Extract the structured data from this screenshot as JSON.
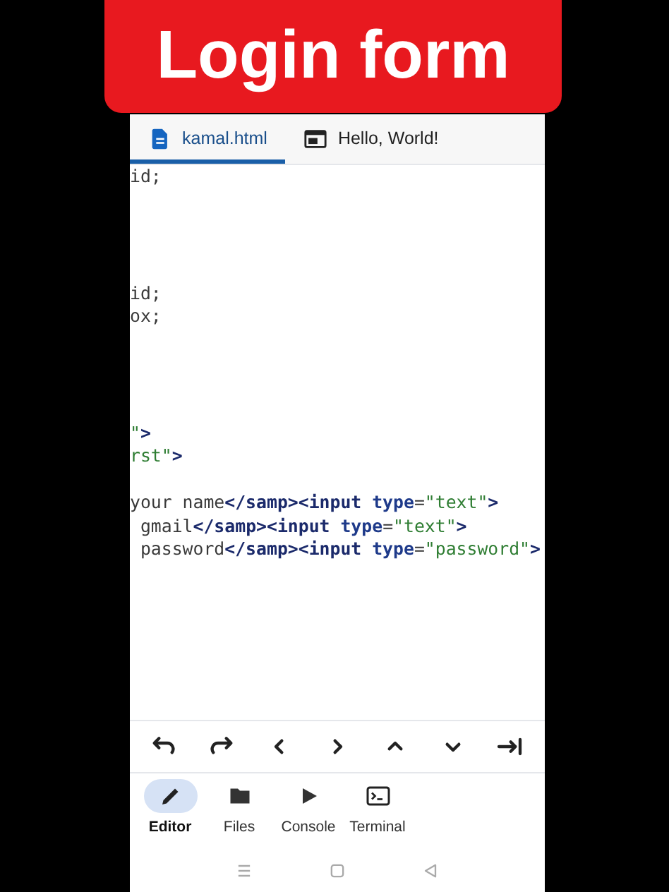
{
  "banner": {
    "title": "Login form"
  },
  "tabs": [
    {
      "label": "kamal.html",
      "selected": true
    },
    {
      "label": "Hello, World!",
      "selected": false
    }
  ],
  "code_lines": [
    {
      "kind": "code",
      "tokens": [
        {
          "kind": "text",
          "text": "id;"
        }
      ]
    },
    {
      "kind": "blank"
    },
    {
      "kind": "blank"
    },
    {
      "kind": "blank"
    },
    {
      "kind": "blank"
    },
    {
      "kind": "code",
      "tokens": [
        {
          "kind": "text",
          "text": "id;"
        }
      ]
    },
    {
      "kind": "code",
      "tokens": [
        {
          "kind": "text",
          "text": "ox;"
        }
      ]
    },
    {
      "kind": "blank"
    },
    {
      "kind": "blank"
    },
    {
      "kind": "blank"
    },
    {
      "kind": "blank"
    },
    {
      "kind": "code",
      "tokens": [
        {
          "kind": "string",
          "text": "\""
        },
        {
          "kind": "tag",
          "text": ">"
        }
      ]
    },
    {
      "kind": "code",
      "tokens": [
        {
          "kind": "string",
          "text": "rst\""
        },
        {
          "kind": "tag",
          "text": ">"
        }
      ]
    },
    {
      "kind": "blank"
    },
    {
      "kind": "code",
      "tokens": [
        {
          "kind": "text",
          "text": "your name"
        },
        {
          "kind": "tag",
          "text": "</samp><input"
        },
        {
          "kind": "attr",
          "text": " type"
        },
        {
          "kind": "text",
          "text": "="
        },
        {
          "kind": "string",
          "text": "\"text\""
        },
        {
          "kind": "tag",
          "text": ">"
        }
      ]
    },
    {
      "kind": "code",
      "tokens": [
        {
          "kind": "text",
          "text": " gmail"
        },
        {
          "kind": "tag",
          "text": "</samp><input"
        },
        {
          "kind": "attr",
          "text": " type"
        },
        {
          "kind": "text",
          "text": "="
        },
        {
          "kind": "string",
          "text": "\"text\""
        },
        {
          "kind": "tag",
          "text": ">"
        }
      ]
    },
    {
      "kind": "code",
      "tokens": [
        {
          "kind": "text",
          "text": " password"
        },
        {
          "kind": "tag",
          "text": "</samp><input"
        },
        {
          "kind": "attr",
          "text": " type"
        },
        {
          "kind": "text",
          "text": "="
        },
        {
          "kind": "string",
          "text": "\"password\""
        },
        {
          "kind": "tag",
          "text": ">"
        }
      ]
    }
  ],
  "bottom_nav": [
    {
      "label": "Editor",
      "selected": true
    },
    {
      "label": "Files",
      "selected": false
    },
    {
      "label": "Console",
      "selected": false
    },
    {
      "label": "Terminal",
      "selected": false
    }
  ]
}
